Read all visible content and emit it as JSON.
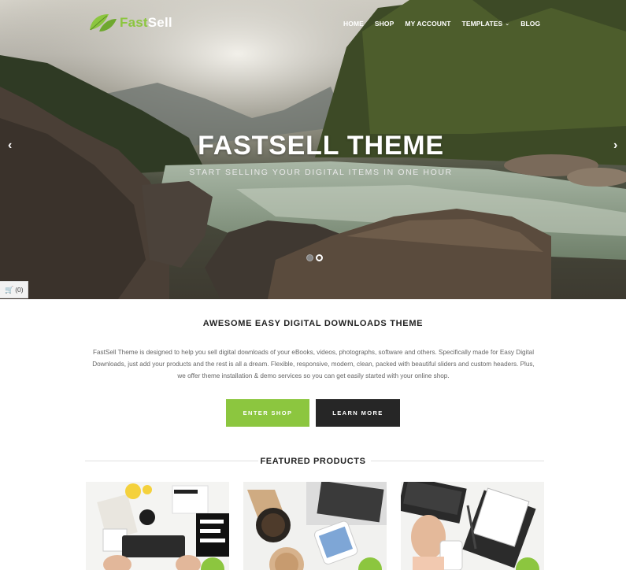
{
  "logo": {
    "part1": "Fast",
    "part2": "Sell",
    "icon": "leaf-icon"
  },
  "nav": {
    "home": "HOME",
    "shop": "SHOP",
    "account": "MY ACCOUNT",
    "templates": "TEMPLATES",
    "blog": "BLOG"
  },
  "hero": {
    "title": "FASTSELL THEME",
    "subtitle": "START SELLING YOUR DIGITAL ITEMS IN ONE HOUR",
    "prev": "‹",
    "next": "›"
  },
  "cart": {
    "label": "(0)",
    "icon": "cart-icon"
  },
  "intro": {
    "heading": "AWESOME EASY DIGITAL DOWNLOADS THEME",
    "body": "FastSell Theme is designed to help you sell digital downloads of your eBooks, videos, photographs, software and others. Specifically made for Easy Digital Downloads, just add your products and the rest is all a dream. Flexible, responsive, modern, clean, packed with beautiful sliders and custom headers. Plus, we offer theme installation & demo services so you can get easily started with your online shop."
  },
  "buttons": {
    "enter": "ENTER SHOP",
    "learn": "LEARN MORE"
  },
  "featured": {
    "title": "FEATURED PRODUCTS"
  },
  "colors": {
    "accent": "#8cc63f",
    "dark": "#262626"
  }
}
